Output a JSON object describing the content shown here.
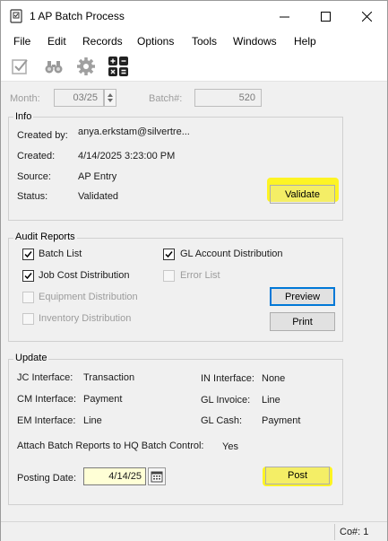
{
  "window": {
    "title": "1 AP Batch Process",
    "controls": {
      "minimize": "minimize-icon",
      "maximize": "maximize-icon",
      "close": "close-icon"
    }
  },
  "menu": [
    "File",
    "Edit",
    "Records",
    "Options",
    "Tools",
    "Windows",
    "Help"
  ],
  "toolbar": {
    "icons": [
      "validate-check-icon",
      "binoculars-icon",
      "gear-icon",
      "calculator-icon"
    ]
  },
  "header": {
    "month_label": "Month:",
    "month_value": "03/25",
    "batch_label": "Batch#:",
    "batch_value": "520"
  },
  "info": {
    "title": "Info",
    "created_by_label": "Created by:",
    "created_by_value": "anya.erkstam@silvertre...",
    "created_label": "Created:",
    "created_value": "4/14/2025 3:23:00 PM",
    "source_label": "Source:",
    "source_value": "AP Entry",
    "status_label": "Status:",
    "status_value": "Validated",
    "validate_button": "Validate"
  },
  "audit": {
    "title": "Audit Reports",
    "batch_list": {
      "label": "Batch List",
      "checked": true,
      "enabled": true
    },
    "gl_account_distribution": {
      "label": "GL Account Distribution",
      "checked": true,
      "enabled": true
    },
    "job_cost_distribution": {
      "label": "Job Cost Distribution",
      "checked": true,
      "enabled": true
    },
    "error_list": {
      "label": "Error List",
      "checked": false,
      "enabled": false
    },
    "equipment_distribution": {
      "label": "Equipment Distribution",
      "checked": false,
      "enabled": false
    },
    "inventory_distribution": {
      "label": "Inventory Distribution",
      "checked": false,
      "enabled": false
    },
    "preview_button": "Preview",
    "print_button": "Print"
  },
  "update": {
    "title": "Update",
    "jc_interface_label": "JC Interface:",
    "jc_interface_value": "Transaction",
    "cm_interface_label": "CM Interface:",
    "cm_interface_value": "Payment",
    "em_interface_label": "EM Interface:",
    "em_interface_value": "Line",
    "in_interface_label": "IN Interface:",
    "in_interface_value": "None",
    "gl_invoice_label": "GL Invoice:",
    "gl_invoice_value": "Line",
    "gl_cash_label": "GL Cash:",
    "gl_cash_value": "Payment",
    "attach_label": "Attach Batch Reports to HQ Batch Control:",
    "attach_value": "Yes",
    "posting_date_label": "Posting Date:",
    "posting_date_value": "4/14/25",
    "post_button": "Post"
  },
  "status_bar": {
    "company": "Co#: 1"
  },
  "colors": {
    "highlight": "#fff500",
    "window_bg": "#f0f0f0",
    "focus_border": "#0078d7",
    "date_bg": "#ffffd6"
  }
}
